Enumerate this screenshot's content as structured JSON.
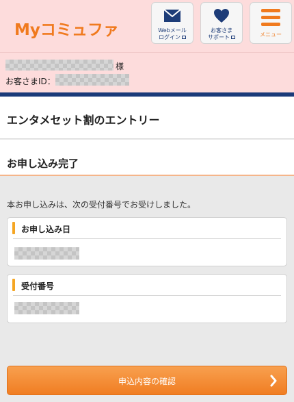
{
  "header": {
    "logo_text": "Myコミュファ",
    "webmail_line1": "Webメール",
    "webmail_line2": "ログイン",
    "support_line1": "お客さま",
    "support_line2": "サポート",
    "menu_label": "メニュー"
  },
  "user": {
    "honorific": "様",
    "customer_id_label": "お客さまID："
  },
  "page": {
    "title": "エンタメセット割のエントリー",
    "subtitle": "お申し込み完了",
    "intro_text": "本お申し込みは、次の受付番号でお受けしました。"
  },
  "cards": {
    "application_date_label": "お申し込み日",
    "receipt_number_label": "受付番号"
  },
  "actions": {
    "confirm_label": "申込内容の確認"
  },
  "colors": {
    "brand_orange": "#f07a1e",
    "navy": "#1b3b7a",
    "header_pink": "#fddcdc"
  }
}
